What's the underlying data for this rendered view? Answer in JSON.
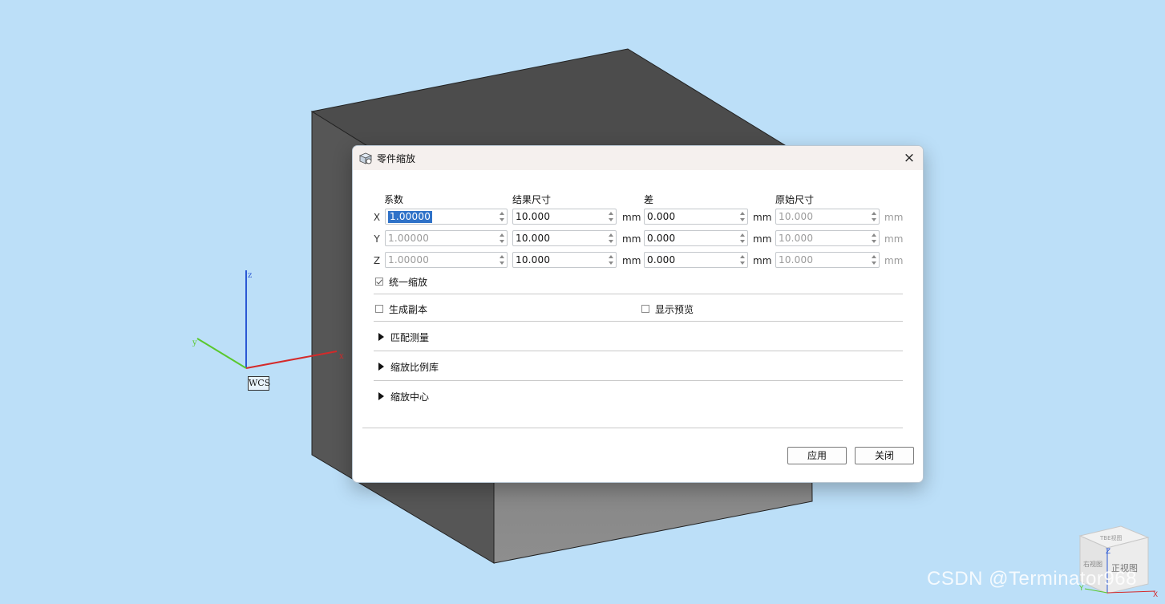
{
  "dialog": {
    "title": "零件缩放",
    "close_symbol": "×",
    "columns": {
      "factor": "系数",
      "result_size": "结果尺寸",
      "difference": "差",
      "original_size": "原始尺寸"
    },
    "rows": [
      {
        "axis": "X",
        "factor": "1.00000",
        "result": "10.000",
        "unit1": "mm",
        "diff": "0.000",
        "unit2": "mm",
        "original": "10.000",
        "unit3": "mm"
      },
      {
        "axis": "Y",
        "factor": "1.00000",
        "result": "10.000",
        "unit1": "mm",
        "diff": "0.000",
        "unit2": "mm",
        "original": "10.000",
        "unit3": "mm"
      },
      {
        "axis": "Z",
        "factor": "1.00000",
        "result": "10.000",
        "unit1": "mm",
        "diff": "0.000",
        "unit2": "mm",
        "original": "10.000",
        "unit3": "mm"
      }
    ],
    "uniform_scale": {
      "label": "统一缩放",
      "checked": true
    },
    "create_copy": {
      "label": "生成副本",
      "checked": false
    },
    "show_preview": {
      "label": "显示预览",
      "checked": false
    },
    "sections": [
      "匹配测量",
      "缩放比例库",
      "缩放中心"
    ],
    "buttons": {
      "apply": "应用",
      "close": "关闭"
    }
  },
  "viewport": {
    "wcs_label": "WCS",
    "axis_x": "x",
    "axis_y": "y",
    "axis_z": "z",
    "view_cube": {
      "top": "TBE视图",
      "front": "正视图",
      "right": "右视图",
      "z": "Z",
      "x": "X",
      "y": "Y"
    },
    "watermark": "CSDN @Terminator968",
    "colors": {
      "background": "#bcdff8",
      "box_dark": "#4a4a4a",
      "x_axis": "#d42a2a",
      "y_axis": "#5ac82e",
      "z_axis": "#2a58d4"
    }
  }
}
